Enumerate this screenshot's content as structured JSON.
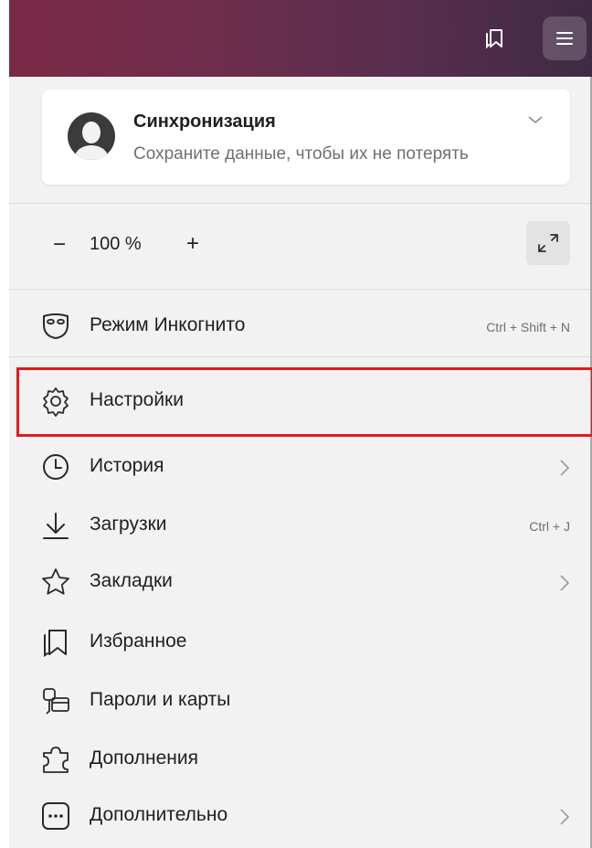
{
  "colors": {
    "accent_highlight": "#e01b1b",
    "menu_background": "#f2f2f2",
    "topbar_gradient_start": "#7a2a46",
    "topbar_gradient_end": "#3f2a44"
  },
  "topbar": {
    "buttons": [
      {
        "icon": "bookmarks-panel-icon"
      },
      {
        "icon": "hamburger-menu-icon"
      }
    ]
  },
  "sync": {
    "title": "Синхронизация",
    "subtitle": "Сохраните данные, чтобы их не потерять",
    "icon": "user-avatar-icon"
  },
  "zoom": {
    "minus": "−",
    "value": "100 %",
    "plus": "+",
    "fullscreen_icon": "fullscreen-expand-icon"
  },
  "menu": {
    "items": [
      {
        "label": "Режим Инкогнито",
        "shortcut": "Ctrl + Shift + N",
        "icon": "incognito-mask-icon"
      },
      {
        "label": "Настройки",
        "shortcut": "",
        "icon": "gear-icon",
        "highlighted": true
      },
      {
        "label": "История",
        "shortcut": "",
        "icon": "clock-icon",
        "submenu": true
      },
      {
        "label": "Загрузки",
        "shortcut": "Ctrl + J",
        "icon": "download-icon"
      },
      {
        "label": "Закладки",
        "shortcut": "",
        "icon": "star-icon",
        "submenu": true
      },
      {
        "label": "Избранное",
        "shortcut": "",
        "icon": "collections-icon"
      },
      {
        "label": "Пароли и карты",
        "shortcut": "",
        "icon": "key-card-icon"
      },
      {
        "label": "Дополнения",
        "shortcut": "",
        "icon": "puzzle-icon"
      },
      {
        "label": "Дополнительно",
        "shortcut": "",
        "icon": "more-icon",
        "submenu": true
      }
    ]
  }
}
